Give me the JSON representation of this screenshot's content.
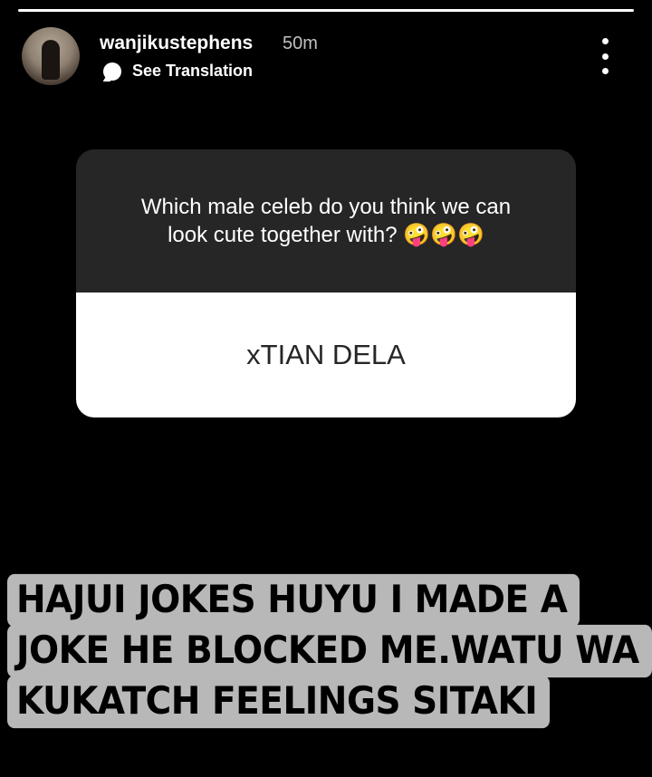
{
  "story": {
    "progress_segments": 1
  },
  "header": {
    "username": "wanjikustephens",
    "time": "50m",
    "translation_label": "See Translation"
  },
  "question_sticker": {
    "question": "Which male celeb do you think we can look cute together with? 🤪🤪🤪",
    "answer": "xTIAN DELA"
  },
  "caption": {
    "lines": [
      "HAJUI JOKES HUYU I MADE A",
      "JOKE HE BLOCKED ME.WATU WA",
      "KUKATCH FEELINGS SITAKI"
    ]
  },
  "icons": {
    "avatar": "avatar",
    "translate": "speech-bubble-icon",
    "more": "more-vertical-icon"
  }
}
